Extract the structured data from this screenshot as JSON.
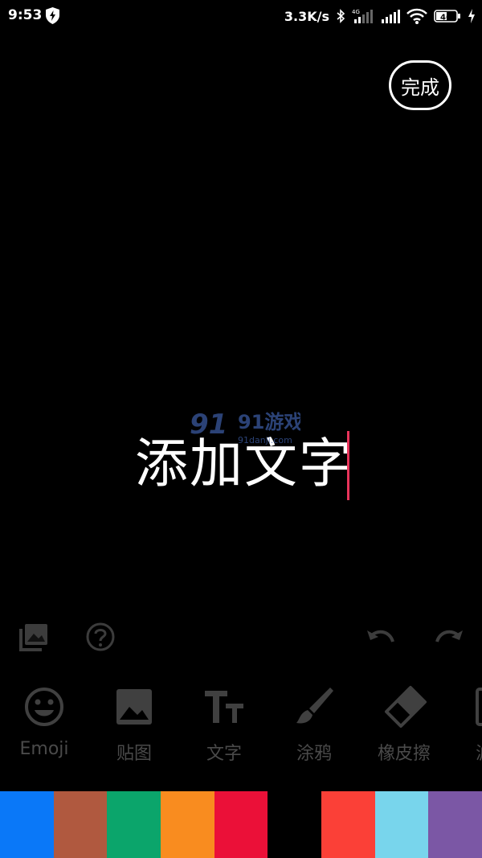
{
  "status_bar": {
    "time": "9:53",
    "speed": "3.3K/s",
    "network": "4G",
    "battery": "46"
  },
  "header": {
    "done_label": "完成"
  },
  "editor": {
    "text": "添加文字",
    "cursor_color": "#e8345a"
  },
  "watermark": {
    "brand": "91游戏",
    "site": "91danji.com"
  },
  "toolbar": {
    "left_icons": [
      "gallery-icon",
      "help-icon"
    ],
    "right_icons": [
      "undo-icon",
      "redo-icon"
    ]
  },
  "bottom_tools": [
    {
      "icon": "emoji-icon",
      "label": "Emoji"
    },
    {
      "icon": "sticker-icon",
      "label": "贴图"
    },
    {
      "icon": "text-icon",
      "label": "文字"
    },
    {
      "icon": "brush-icon",
      "label": "涂鸦"
    },
    {
      "icon": "eraser-icon",
      "label": "橡皮擦"
    },
    {
      "icon": "more-icon",
      "label": "滤"
    }
  ],
  "palette": {
    "colors": [
      "#0a78f8",
      "#b0593f",
      "#0ba56b",
      "#f98c1f",
      "#eb1038",
      "#000000",
      "#fb4037",
      "#78d5ec",
      "#7b57a5"
    ]
  }
}
